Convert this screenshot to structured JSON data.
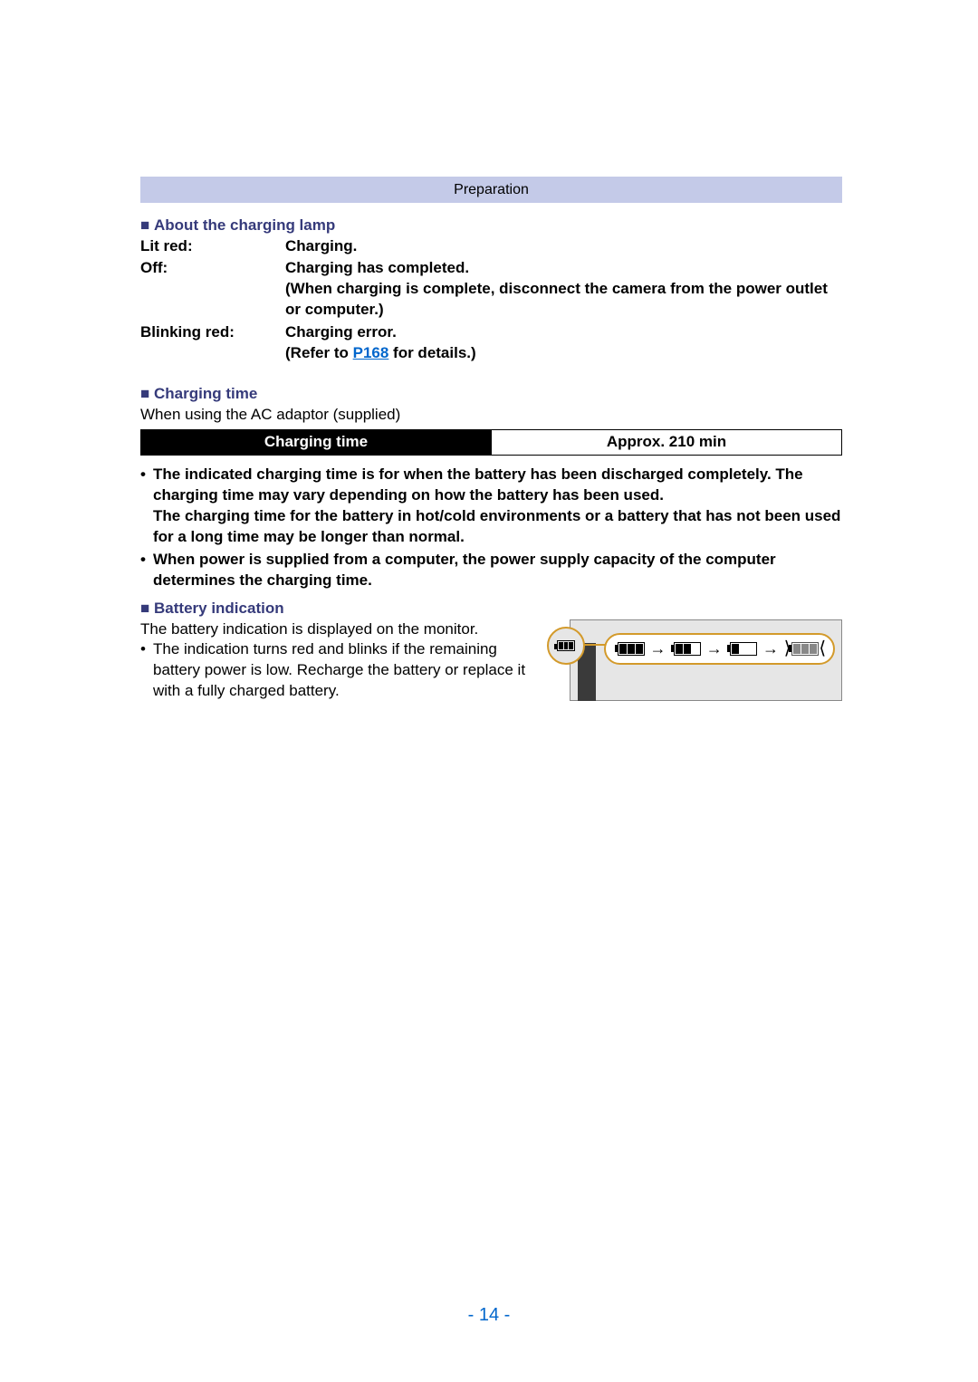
{
  "header": "Preparation",
  "section1": {
    "title": "About the charging lamp",
    "rows": [
      {
        "label": "Lit red:",
        "desc": "Charging."
      },
      {
        "label": "Off:",
        "desc": "Charging has completed.\n(When charging is complete, disconnect the camera from the power outlet or computer.)"
      },
      {
        "label": "Blinking red:",
        "desc_pre": "Charging error.\n(Refer to ",
        "link": "P168",
        "desc_post": " for details.)"
      }
    ]
  },
  "section2": {
    "title": "Charging time",
    "intro": "When using the AC adaptor (supplied)",
    "table": {
      "header": "Charging time",
      "value": "Approx. 210 min"
    },
    "notes": [
      "The indicated charging time is for when the battery has been discharged completely. The charging time may vary depending on how the battery has been used.\nThe charging time for the battery in hot/cold environments or a battery that has not been used for a long time may be longer than normal.",
      "When power is supplied from a computer, the power supply capacity of the computer determines the charging time."
    ]
  },
  "section3": {
    "title": "Battery indication",
    "line1": "The battery indication is displayed on the monitor.",
    "bullet": "The indication turns red and blinks if the remaining battery power is low. Recharge the battery or replace it with a fully charged battery."
  },
  "page_number": "- 14 -"
}
